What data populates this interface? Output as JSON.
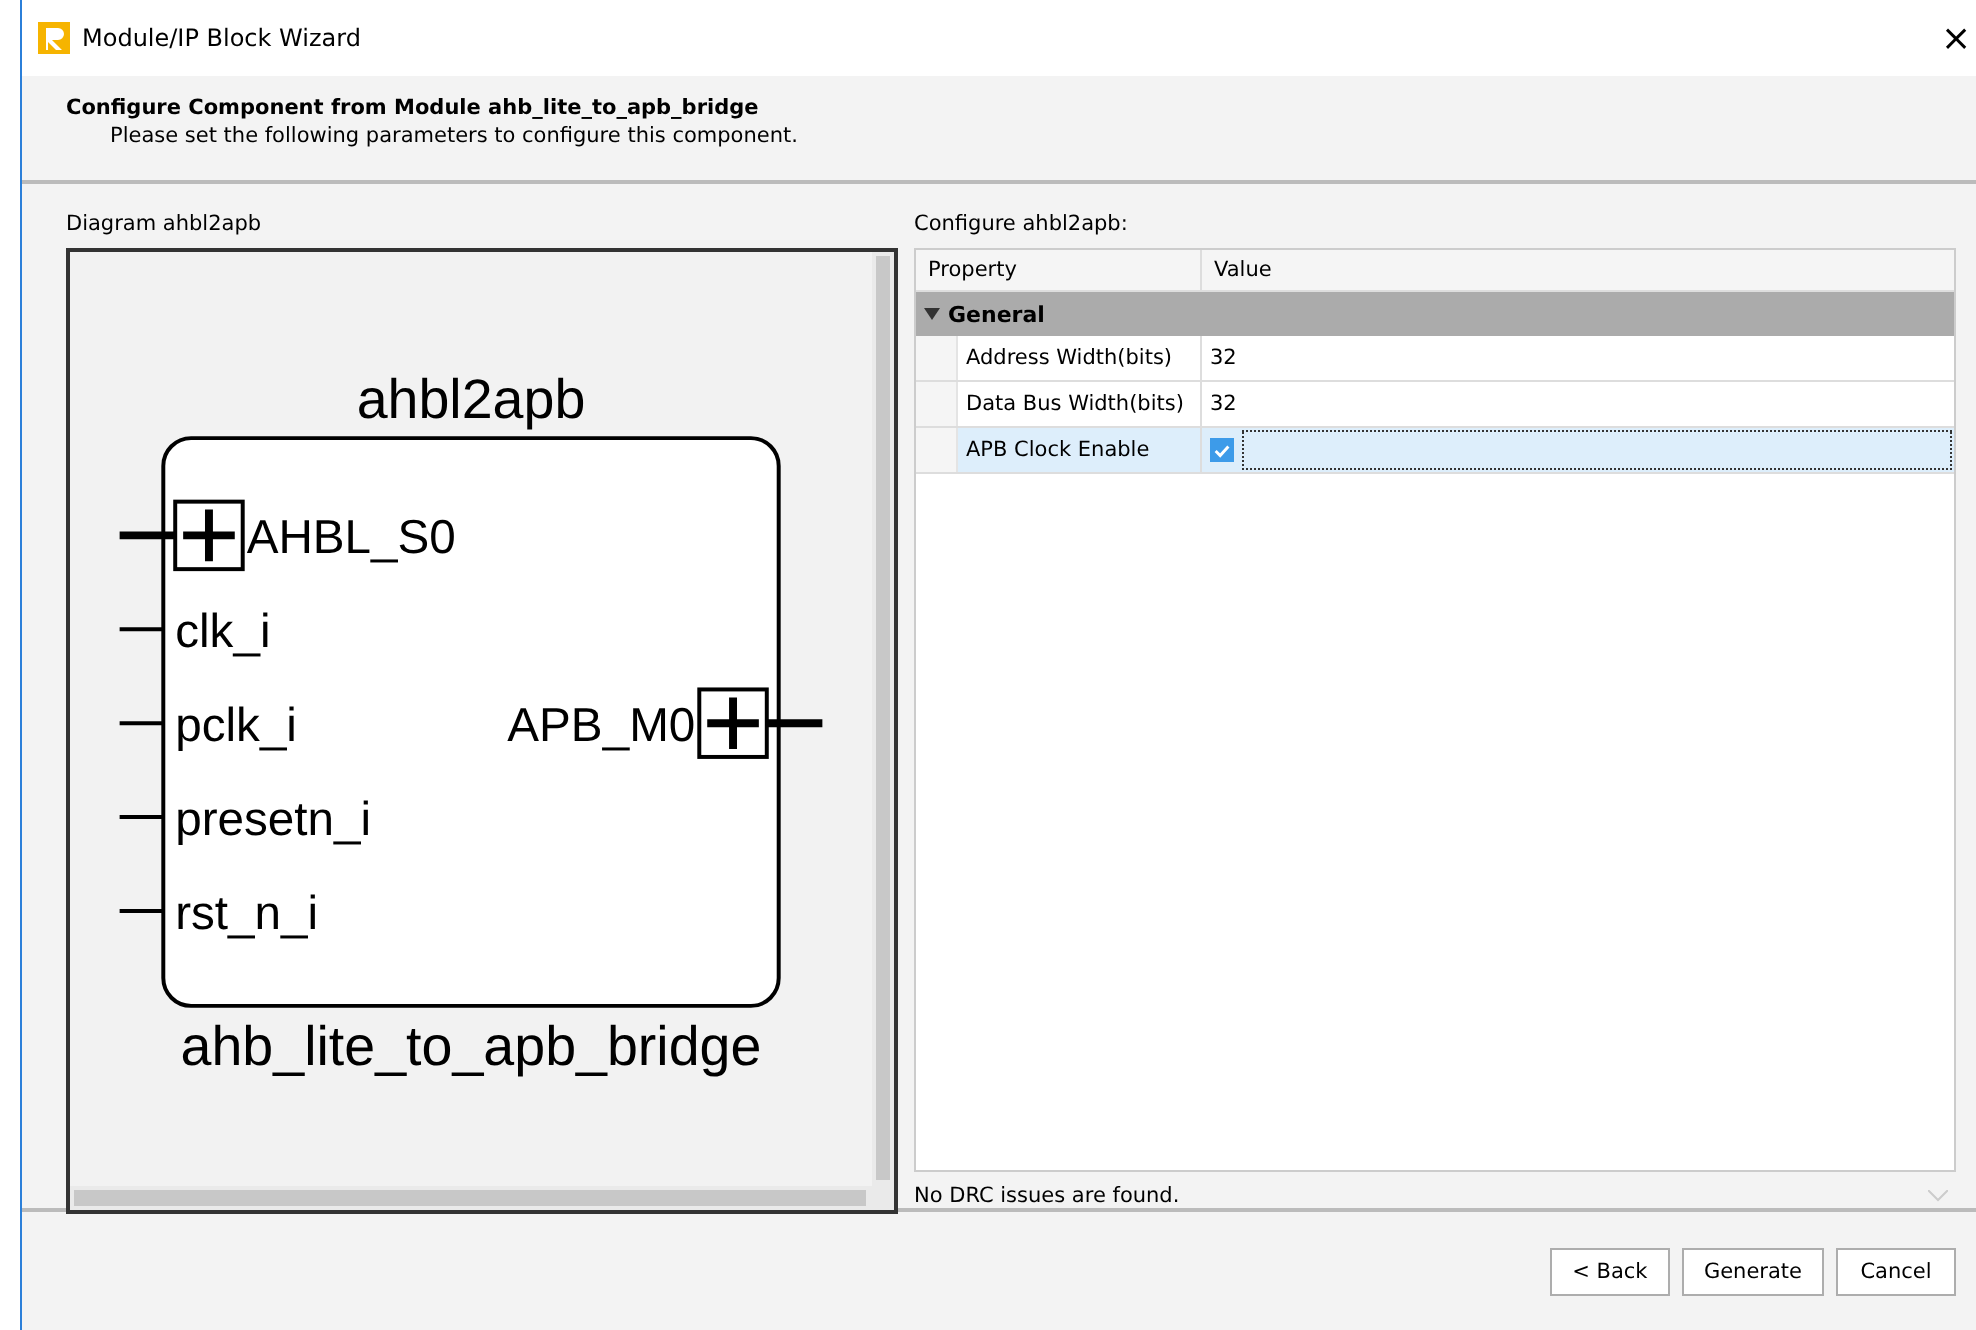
{
  "window": {
    "title": "Module/IP Block Wizard",
    "close": "×"
  },
  "header": {
    "title": "Configure Component from Module ahb_lite_to_apb_bridge",
    "subtitle": "Please set the following parameters to configure this component."
  },
  "diagram": {
    "label": "Diagram ahbl2apb",
    "instance": "ahbl2apb",
    "module": "ahb_lite_to_apb_bridge",
    "left_ports": [
      {
        "name": "AHBL_S0",
        "kind": "bus"
      },
      {
        "name": "clk_i",
        "kind": "signal"
      },
      {
        "name": "pclk_i",
        "kind": "signal"
      },
      {
        "name": "presetn_i",
        "kind": "signal"
      },
      {
        "name": "rst_n_i",
        "kind": "signal"
      }
    ],
    "right_ports": [
      {
        "name": "APB_M0",
        "kind": "bus"
      }
    ]
  },
  "config": {
    "label": "Configure ahbl2apb:",
    "columns": [
      "Property",
      "Value"
    ],
    "groups": [
      {
        "name": "General",
        "expanded": true,
        "rows": [
          {
            "property": "Address Width(bits)",
            "kind": "text",
            "value": "32",
            "selected": false
          },
          {
            "property": "Data Bus Width(bits)",
            "kind": "text",
            "value": "32",
            "selected": false
          },
          {
            "property": "APB Clock Enable",
            "kind": "checkbox",
            "checked": true,
            "selected": true
          }
        ]
      }
    ]
  },
  "status": "No DRC issues are found.",
  "buttons": [
    {
      "label": "< Back"
    },
    {
      "label": "Generate"
    },
    {
      "label": "Cancel"
    }
  ]
}
